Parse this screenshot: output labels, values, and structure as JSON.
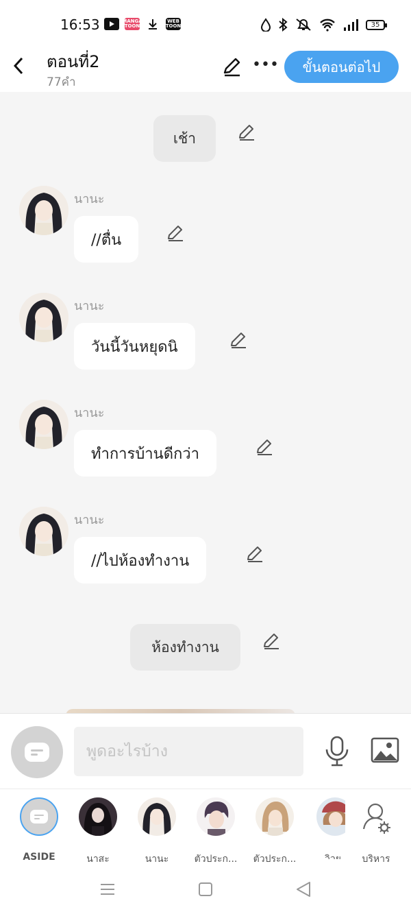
{
  "status_bar": {
    "time": "16:53",
    "app_icons": [
      "youtube-icon",
      "manga-toon-icon",
      "download-icon",
      "webtoon-icon"
    ],
    "manga_label": "MANGA TOON",
    "webtoon_label": "WEB TOON",
    "battery": "35"
  },
  "header": {
    "title": "ตอนที่2",
    "word_count": "77คำ",
    "next_button": "ขั้นตอนต่อไป"
  },
  "chat": {
    "scenes": [
      {
        "text": "เช้า"
      },
      {
        "text": "ห้องทำงาน"
      }
    ],
    "messages": [
      {
        "sender": "นานะ",
        "text": "//ตื่น"
      },
      {
        "sender": "นานะ",
        "text": "วันนี้วันหยุดนิ"
      },
      {
        "sender": "นานะ",
        "text": "ทำการบ้านดีกว่า"
      },
      {
        "sender": "นานะ",
        "text": "//ไปห้องทำงาน"
      }
    ]
  },
  "input": {
    "placeholder": "พูดอะไรบ้าง"
  },
  "characters": [
    {
      "name": "ASIDE"
    },
    {
      "name": "นาสะ"
    },
    {
      "name": "นานะ"
    },
    {
      "name": "ตัวประก..."
    },
    {
      "name": "ตัวประก..."
    },
    {
      "name": "วิวย"
    },
    {
      "name": "บริหาร"
    }
  ],
  "colors": {
    "accent": "#4aa3f0",
    "background": "#f5f5f5",
    "scene_bg": "#e9e9e9"
  }
}
